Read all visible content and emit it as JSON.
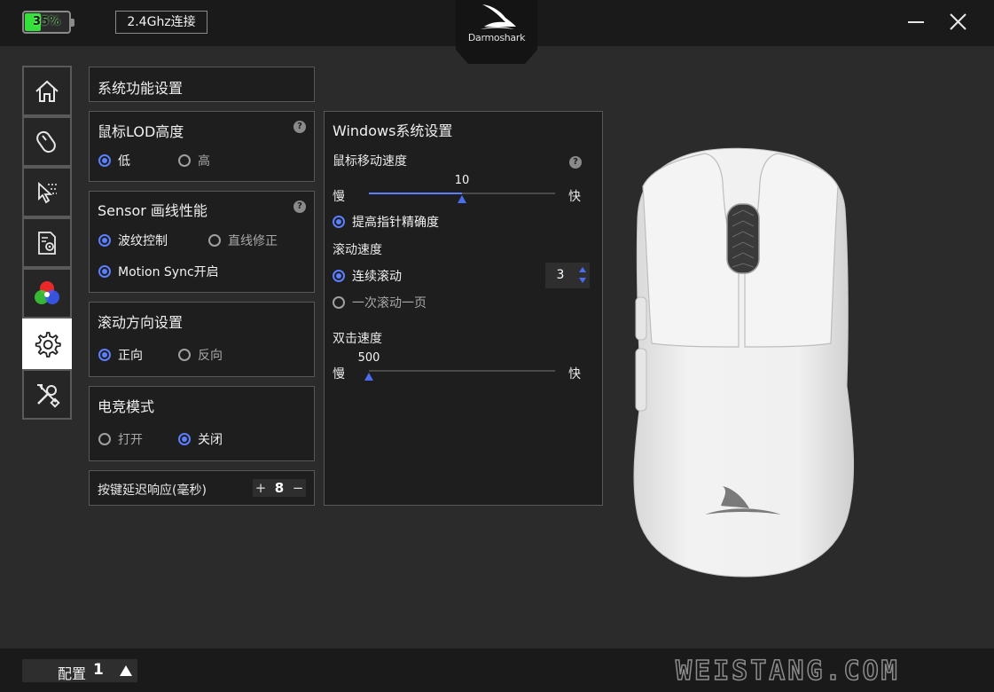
{
  "topbar": {
    "battery_percent_text": "35%",
    "battery_level": 0.35,
    "connection": "2.4Ghz连接",
    "brand": "Darmoshark"
  },
  "nav": {
    "items": [
      {
        "icon": "home-icon"
      },
      {
        "icon": "mouse-icon"
      },
      {
        "icon": "pointer-icon"
      },
      {
        "icon": "document-settings-icon"
      },
      {
        "icon": "rgb-icon"
      },
      {
        "icon": "gear-icon",
        "active": true
      },
      {
        "icon": "tools-icon"
      }
    ]
  },
  "system": {
    "title": "系统功能设置",
    "lod": {
      "title": "鼠标LOD高度",
      "options": [
        "低",
        "高"
      ],
      "selected": "低"
    },
    "sensor": {
      "title": "Sensor 画线性能",
      "ripple": "波纹控制",
      "angle": "直线修正",
      "motion_sync": "Motion Sync开启"
    },
    "scroll_dir": {
      "title": "滚动方向设置",
      "options": [
        "正向",
        "反向"
      ],
      "selected": "正向"
    },
    "esports": {
      "title": "电竞模式",
      "options": [
        "打开",
        "关闭"
      ],
      "selected": "关闭"
    },
    "debounce": {
      "label": "按键延迟响应(毫秒)",
      "plus": "+",
      "value": "8",
      "minus": "−"
    }
  },
  "windows": {
    "title": "Windows系统设置",
    "pointer_speed": {
      "label": "鼠标移动速度",
      "value": "10",
      "fraction": 0.5,
      "slow": "慢",
      "fast": "快"
    },
    "precision": "提高指针精确度",
    "scroll_speed": {
      "label": "滚动速度",
      "continuous": "连续滚动",
      "page": "一次滚动一页",
      "lines": "3"
    },
    "double_click": {
      "label": "双击速度",
      "value": "500",
      "fraction": 0.0,
      "slow": "慢",
      "fast": "快"
    }
  },
  "help_mark": "?",
  "bottom": {
    "profile_label": "配置",
    "profile_number": "1",
    "watermark": "WEISTANG.COM"
  },
  "colors": {
    "accent": "#5b7fff",
    "battery": "#35e03a",
    "background": "#2b2b2b"
  }
}
